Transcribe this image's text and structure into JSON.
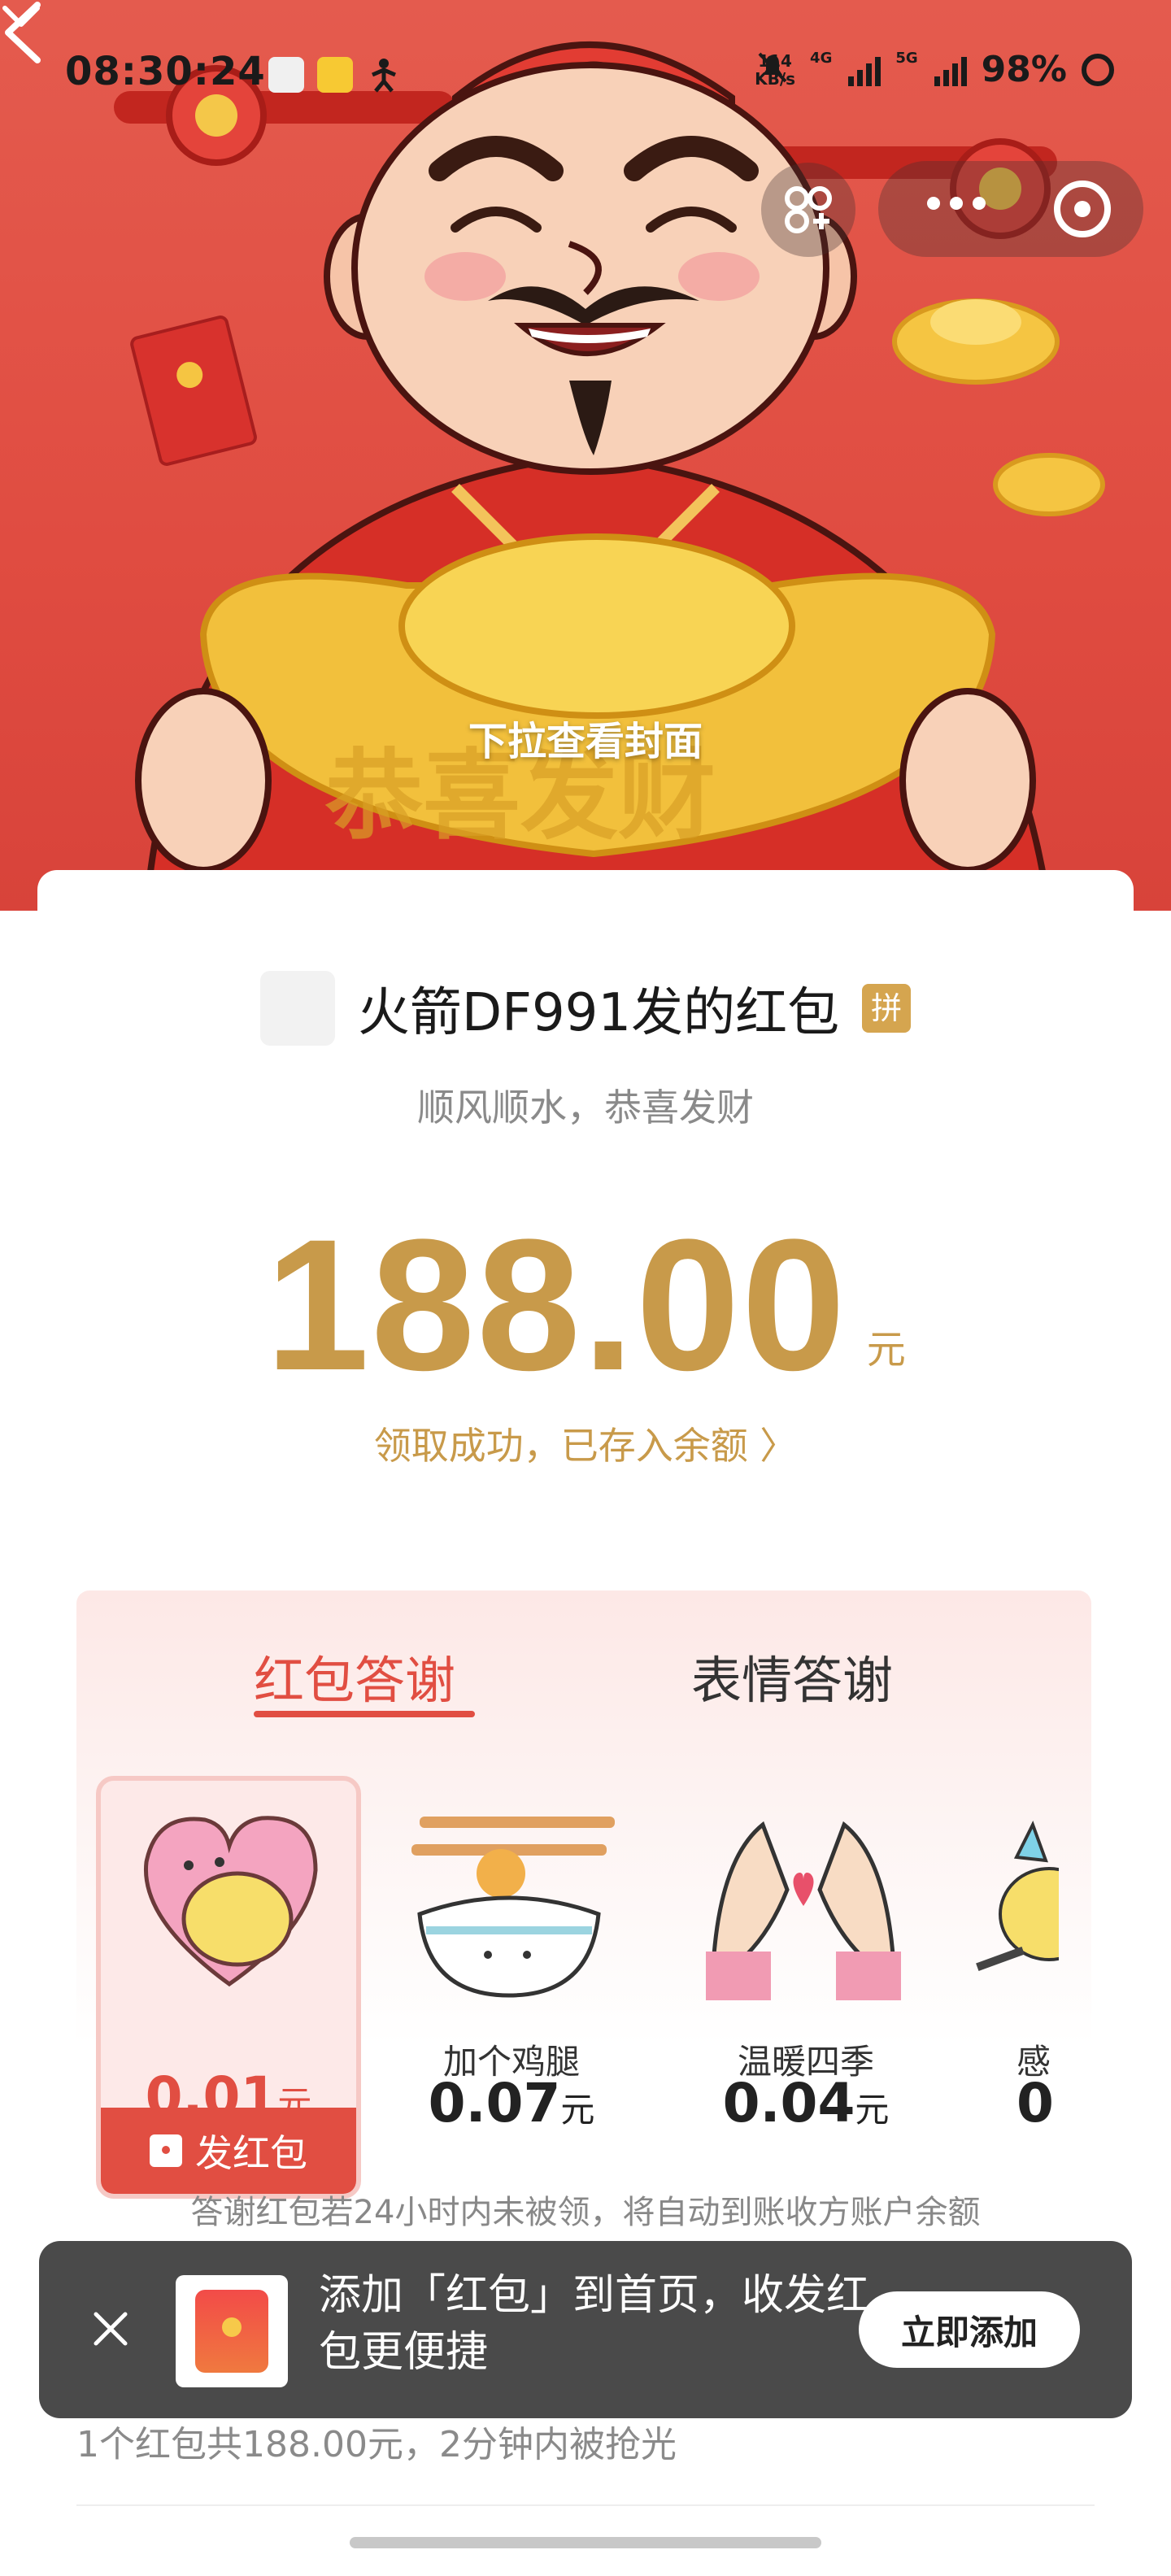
{
  "status_bar": {
    "time": "08:30:24",
    "netspeed_value": "114",
    "netspeed_unit": "KB/s",
    "sim1": "4G",
    "sim2": "5G",
    "battery": "98%"
  },
  "cover": {
    "pull_hint": "下拉查看封面",
    "background_color": "#e04c41",
    "ingot_text": "恭喜发财"
  },
  "packet": {
    "sender": "火箭DF991发的红包",
    "sender_badge": "拼",
    "blessing": "顺风顺水，恭喜发财",
    "amount": "188.00",
    "amount_unit": "元",
    "status": "领取成功，已存入余额 〉"
  },
  "thanks": {
    "tabs": [
      {
        "label": "红包答谢",
        "active": true
      },
      {
        "label": "表情答谢",
        "active": false
      }
    ],
    "gifts": [
      {
        "name": "",
        "price": "0.01",
        "unit": "元",
        "selected": true,
        "icon": "heart-hug-icon"
      },
      {
        "name": "加个鸡腿",
        "price": "0.07",
        "unit": "元",
        "selected": false,
        "icon": "rice-bowl-drumstick-icon"
      },
      {
        "name": "温暖四季",
        "price": "0.04",
        "unit": "元",
        "selected": false,
        "icon": "hands-heart-icon"
      },
      {
        "name": "感",
        "price": "0",
        "unit": "",
        "selected": false,
        "icon": "star-character-icon"
      }
    ],
    "send_button": "发红包",
    "note": "答谢红包若24小时内未被领，将自动到账收方账户余额"
  },
  "summary": "1个红包共188.00元，2分钟内被抢光",
  "toast": {
    "text": "添加「红包」到首页，收发红包更便捷",
    "button": "立即添加"
  },
  "colors": {
    "accent_red": "#e14e42",
    "gold": "#c89a4a"
  }
}
